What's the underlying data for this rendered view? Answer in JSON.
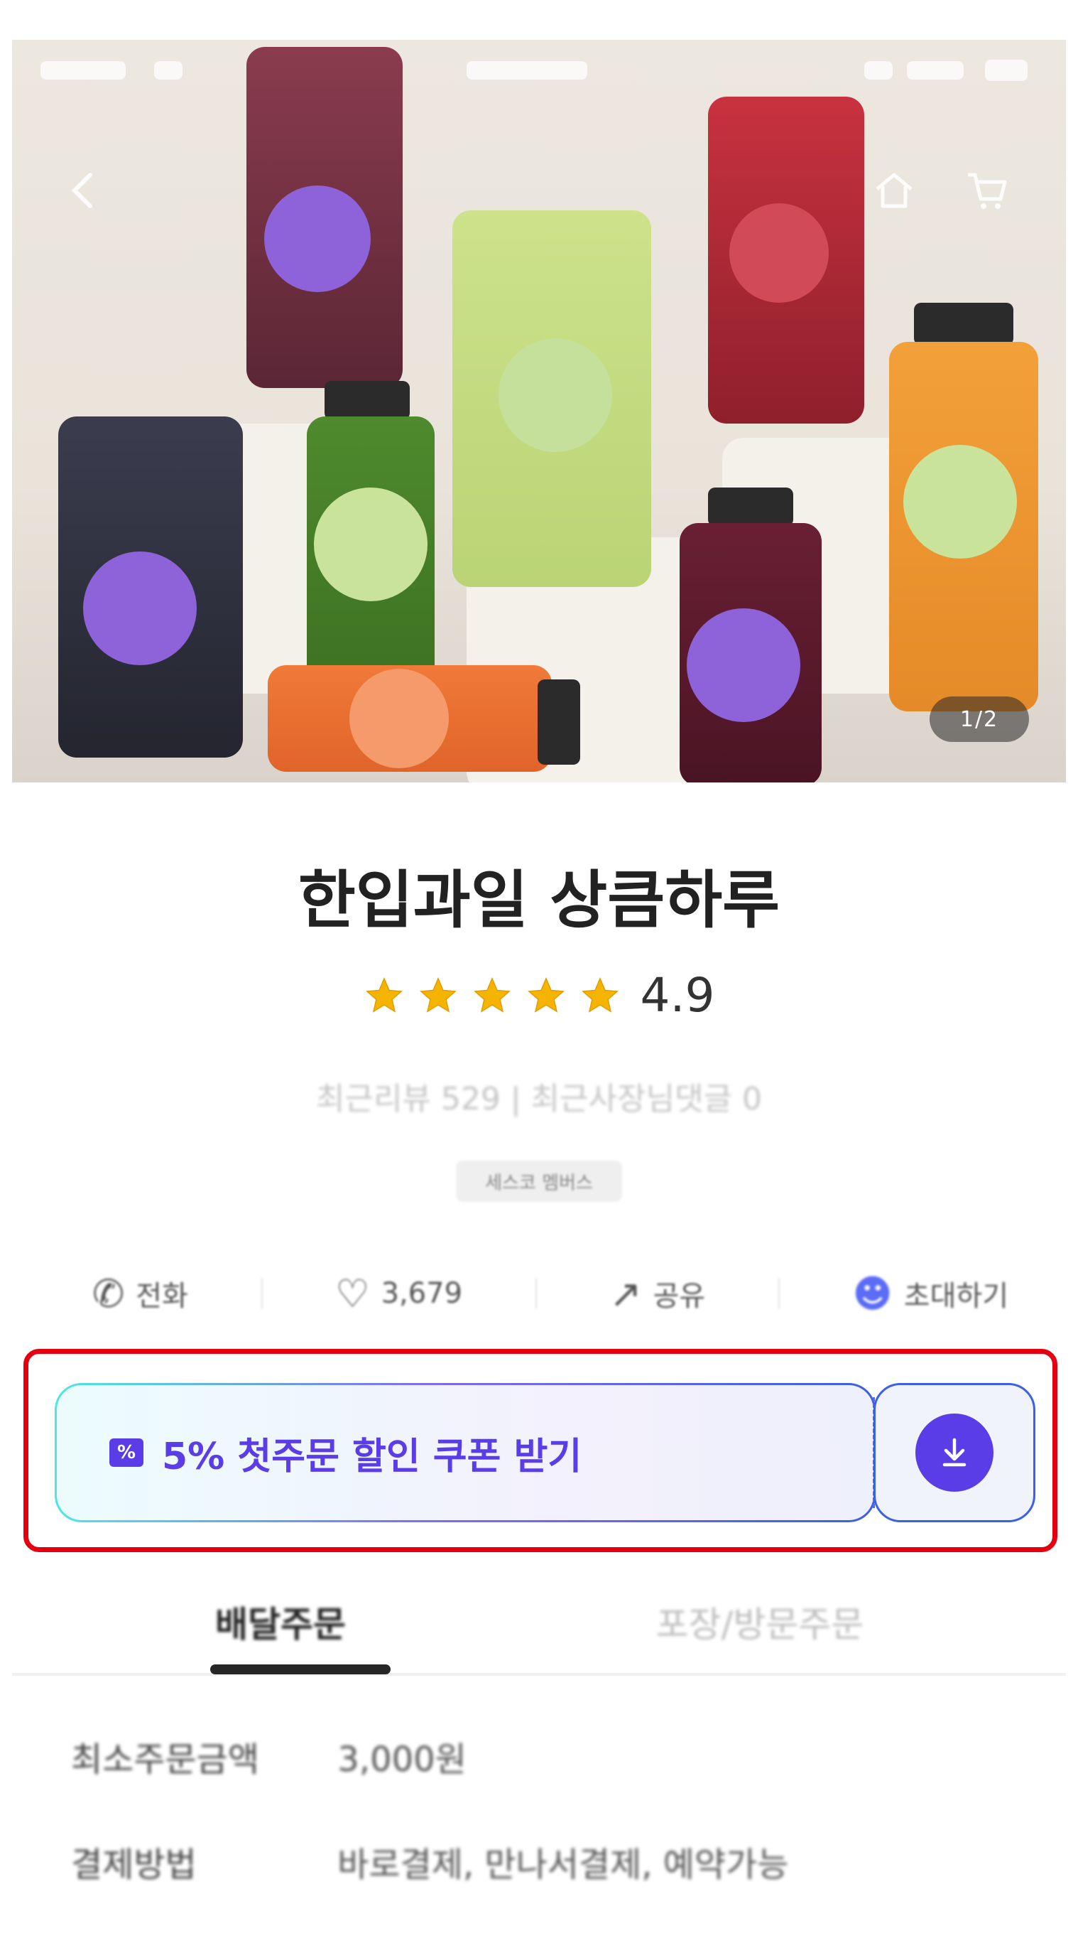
{
  "hero": {
    "image_counter": "1/2"
  },
  "store": {
    "name": "한입과일 상큼하루",
    "rating": "4.9",
    "stars": 5,
    "reviews": "최근리뷰 529 | 최근사장님댓글 0",
    "tag": "세스코 멤버스"
  },
  "actions": [
    {
      "icon": "phone-icon",
      "label": "전화"
    },
    {
      "icon": "heart-icon",
      "label": "3,679"
    },
    {
      "icon": "share-icon",
      "label": "공유"
    },
    {
      "icon": "invite-icon",
      "label": "초대하기"
    }
  ],
  "coupon": {
    "icon_glyph": "%",
    "text": "5% 첫주문 할인 쿠폰 받기",
    "download_icon": "download-icon",
    "accent_color": "#5a3de6",
    "highlight_color": "#e4000f"
  },
  "tabs": {
    "active": "배달주문",
    "inactive": "포장/방문주문"
  },
  "info": [
    {
      "key": "최소주문금액",
      "value": "3,000원"
    },
    {
      "key": "결제방법",
      "value": "바로결제, 만나서결제, 예약가능"
    }
  ]
}
